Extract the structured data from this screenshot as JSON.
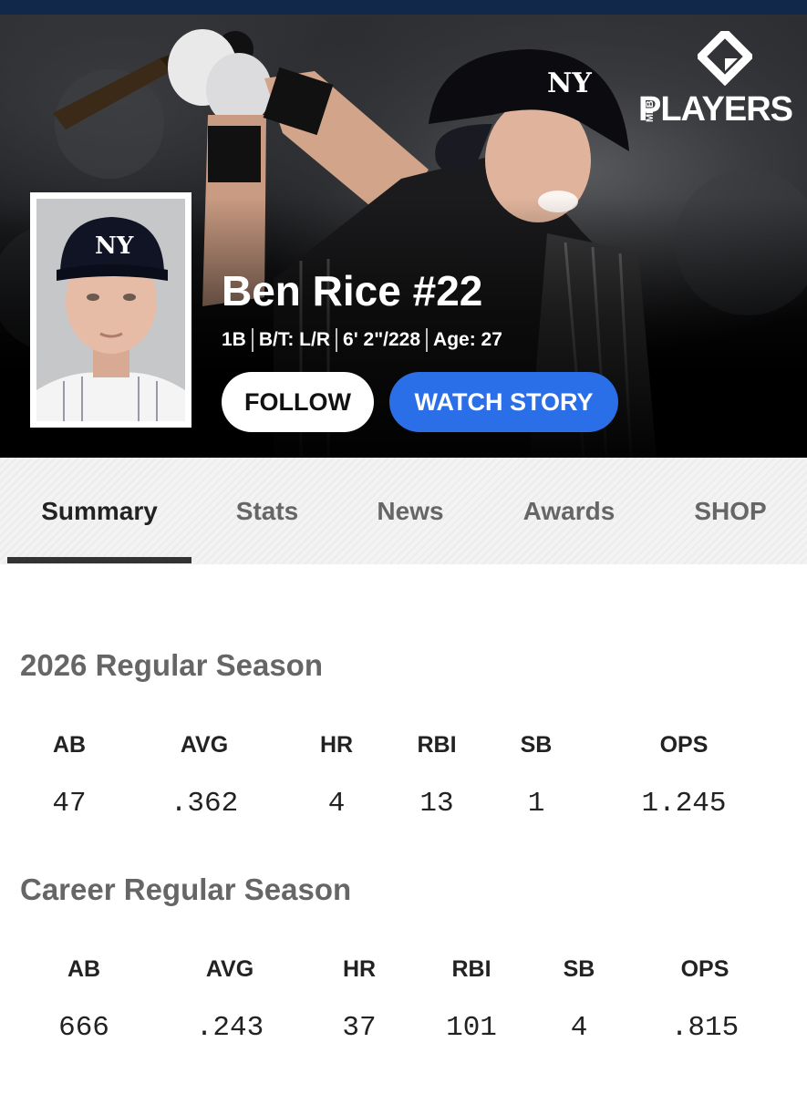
{
  "brand": {
    "logo_text": "PLAYERS",
    "logo_sub": "MLB"
  },
  "player": {
    "name": "Ben Rice #22",
    "position": "1B",
    "bats_throws": "B/T: L/R",
    "height_weight": "6' 2\"/228",
    "age": "Age: 27"
  },
  "actions": {
    "follow_label": "FOLLOW",
    "watch_label": "WATCH STORY"
  },
  "colors": {
    "watch_button": "#2b6fe8",
    "top_bar": "#12284b"
  },
  "tabs": [
    {
      "label": "Summary",
      "active": true
    },
    {
      "label": "Stats",
      "active": false
    },
    {
      "label": "News",
      "active": false
    },
    {
      "label": "Awards",
      "active": false
    },
    {
      "label": "SHOP",
      "active": false
    }
  ],
  "season": {
    "title": "2026 Regular Season",
    "headers": [
      "AB",
      "AVG",
      "HR",
      "RBI",
      "SB",
      "OPS"
    ],
    "values": [
      "47",
      ".362",
      "4",
      "13",
      "1",
      "1.245"
    ]
  },
  "career": {
    "title": "Career Regular Season",
    "headers": [
      "AB",
      "AVG",
      "HR",
      "RBI",
      "SB",
      "OPS"
    ],
    "values": [
      "666",
      ".243",
      "37",
      "101",
      "4",
      ".815"
    ]
  }
}
